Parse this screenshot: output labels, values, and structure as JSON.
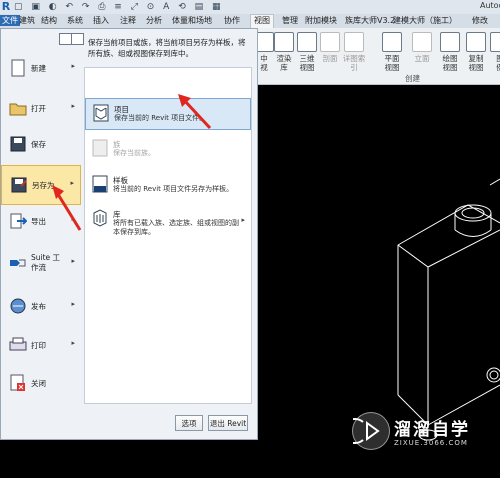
{
  "title_bar": {
    "app_title": "Autod"
  },
  "tabs": [
    "文件",
    "建筑",
    "结构",
    "系统",
    "插入",
    "注释",
    "分析",
    "体量和场地",
    "协作",
    "视图",
    "管理",
    "附加模块",
    "族库大师V3.2",
    "建模大师（施工）",
    "修改"
  ],
  "active_tab": "视图",
  "ribbon": {
    "buttons": [
      {
        "label": "中\n视",
        "dim": false
      },
      {
        "label": "渲染\n库",
        "dim": false
      },
      {
        "label": "三维\n视图",
        "dim": false
      },
      {
        "label": "剖面",
        "dim": true
      },
      {
        "label": "详图索引",
        "dim": true
      },
      {
        "label": "平面\n视图",
        "dim": false
      },
      {
        "label": "立面",
        "dim": true
      },
      {
        "label": "绘图\n视图",
        "dim": false
      },
      {
        "label": "复制\n视图",
        "dim": false
      },
      {
        "label": "图\n例",
        "dim": false
      }
    ],
    "group_label": "创建"
  },
  "app_menu": {
    "items": [
      {
        "label": "新建",
        "arrow": true,
        "icon": "new-document-icon"
      },
      {
        "label": "打开",
        "arrow": true,
        "icon": "open-folder-icon"
      },
      {
        "label": "保存",
        "arrow": false,
        "icon": "save-icon"
      },
      {
        "label": "另存为",
        "arrow": true,
        "icon": "save-as-icon",
        "active": true
      },
      {
        "label": "导出",
        "arrow": true,
        "icon": "export-icon"
      },
      {
        "label": "Suite 工作流",
        "arrow": true,
        "icon": "suite-workflow-icon"
      },
      {
        "label": "发布",
        "arrow": true,
        "icon": "publish-icon"
      },
      {
        "label": "打印",
        "arrow": true,
        "icon": "print-icon"
      },
      {
        "label": "关闭",
        "arrow": false,
        "icon": "close-file-icon"
      }
    ],
    "panel_header": "保存当前项目或族，将当前项目另存为样板，将所有族、组或视图保存到库中。",
    "sub_items": [
      {
        "title": "项目",
        "desc": "保存当前的 Revit 项目文件。",
        "icon": "project-icon",
        "active": true,
        "dim": false
      },
      {
        "title": "族",
        "desc": "保存当前族。",
        "icon": "family-icon",
        "active": false,
        "dim": true
      },
      {
        "title": "样板",
        "desc": "将当前的 Revit 项目文件另存为样板。",
        "icon": "template-icon",
        "active": false,
        "dim": false
      },
      {
        "title": "库",
        "desc": "将所有已载入族、选定族、组或视图的副本保存到库。",
        "icon": "library-icon",
        "active": false,
        "dim": false,
        "arrow": true
      }
    ],
    "options_button": "选项",
    "exit_button": "退出 Revit",
    "top_tools": [
      "",
      ""
    ]
  },
  "watermark": {
    "title": "溜溜自学",
    "url": "ZIXUE.3066.COM"
  }
}
